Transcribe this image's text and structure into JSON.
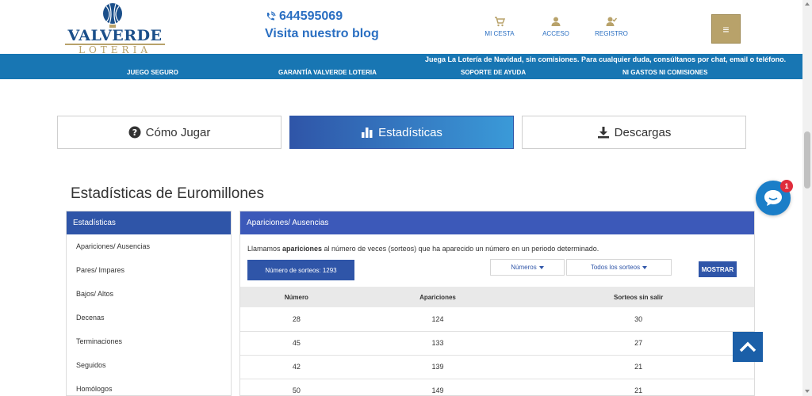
{
  "header": {
    "logo_brand": "VALVERDE",
    "logo_sub": "LOTERIA",
    "phone": "644595069",
    "blog_link": "Visita nuestro blog",
    "nav": {
      "cart": "MI CESTA",
      "login": "ACCESO",
      "register": "REGISTRO"
    },
    "menu_icon": "≡"
  },
  "bluebar": {
    "notice": "Juega La Lotería de Navidad, sin comisiones. Para cualquier duda, consúltanos por chat, email o teléfono.",
    "links": [
      "JUEGO SEGURO",
      "GARANTÍA VALVERDE LOTERIA",
      "SOPORTE DE AYUDA",
      "NI GASTOS NI COMISIONES"
    ]
  },
  "tabs": [
    {
      "label": "Cómo Jugar",
      "icon": "question-circle-icon",
      "active": false
    },
    {
      "label": "Estadísticas",
      "icon": "bar-chart-icon",
      "active": true
    },
    {
      "label": "Descargas",
      "icon": "download-icon",
      "active": false
    }
  ],
  "page_title": "Estadísticas de Euromillones",
  "sidebar": {
    "title": "Estadísticas",
    "items": [
      "Apariciones/ Ausencias",
      "Pares/ Impares",
      "Bajos/ Altos",
      "Decenas",
      "Terminaciones",
      "Seguidos",
      "Homólogos"
    ]
  },
  "panel": {
    "title": "Apariciones/ Ausencias",
    "desc_pre": "Llamamos ",
    "desc_bold": "apariciones",
    "desc_post": " al número de veces (sorteos) que ha aparecido un número en un periodo determinado.",
    "sorteos_label": "Número de sorteos: 1293",
    "dropdown_numeros": "Números",
    "dropdown_sorteos": "Todos los sorteos",
    "mostrar_button": "MOSTRAR",
    "table": {
      "headers": [
        "Número",
        "Apariciones",
        "Sorteos sin salir"
      ],
      "rows": [
        [
          "28",
          "124",
          "30"
        ],
        [
          "45",
          "133",
          "27"
        ],
        [
          "42",
          "139",
          "21"
        ],
        [
          "50",
          "149",
          "21"
        ]
      ]
    }
  },
  "chat": {
    "badge": "1"
  },
  "colors": {
    "primary_blue": "#2f55a8",
    "bar_blue": "#1876b3",
    "gold": "#b8a26a",
    "link_blue": "#2a6fc2"
  }
}
